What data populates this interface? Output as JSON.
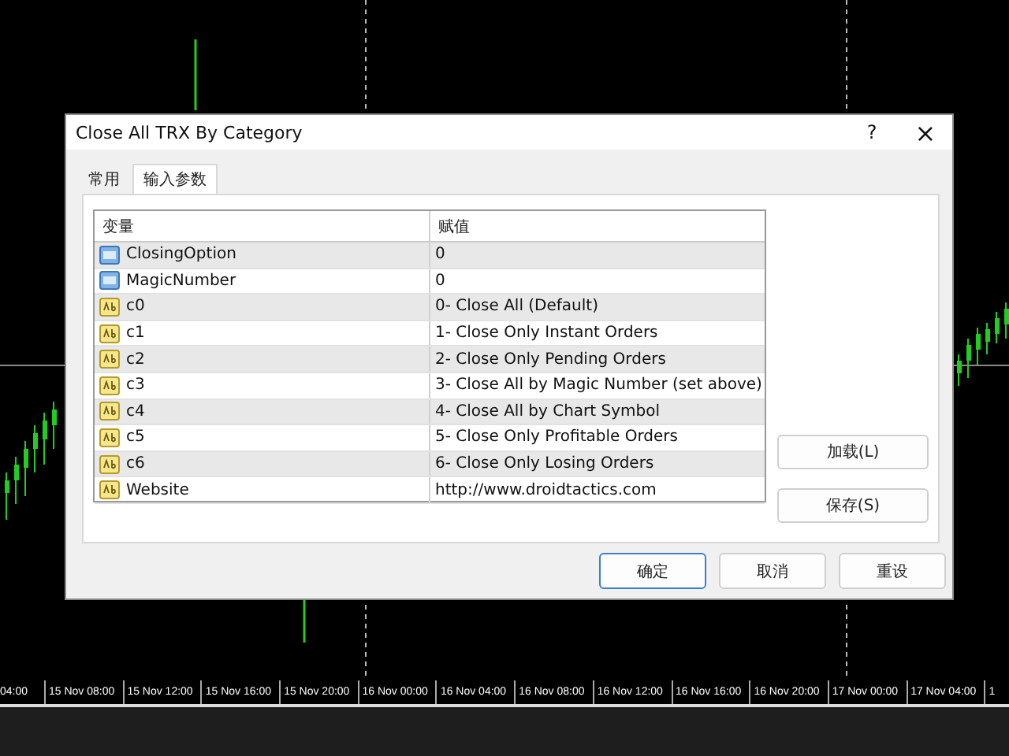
{
  "dialog": {
    "title": "Close All TRX By Category",
    "help_button": "?",
    "close_button": "×"
  },
  "tabs": [
    {
      "label": "常用",
      "selected": false
    },
    {
      "label": "输入参数",
      "selected": true
    }
  ],
  "table": {
    "columns": [
      "变量",
      "赋值"
    ],
    "rows": [
      {
        "kind": "number",
        "name": "ClosingOption",
        "value": "0"
      },
      {
        "kind": "number",
        "name": "MagicNumber",
        "value": "0"
      },
      {
        "kind": "text",
        "name": "c0",
        "value": "0- Close All (Default)"
      },
      {
        "kind": "text",
        "name": "c1",
        "value": "1- Close Only Instant Orders"
      },
      {
        "kind": "text",
        "name": "c2",
        "value": "2- Close Only Pending Orders"
      },
      {
        "kind": "text",
        "name": "c3",
        "value": "3- Close All by Magic Number (set above)"
      },
      {
        "kind": "text",
        "name": "c4",
        "value": "4- Close All by Chart Symbol"
      },
      {
        "kind": "text",
        "name": "c5",
        "value": "5- Close Only Profitable Orders"
      },
      {
        "kind": "text",
        "name": "c6",
        "value": "6- Close Only Losing Orders"
      },
      {
        "kind": "text",
        "name": "Website",
        "value": "http://www.droidtactics.com"
      }
    ]
  },
  "side_buttons": [
    "加载(L)",
    "保存(S)"
  ],
  "footer_buttons": [
    {
      "label": "确定",
      "default": true
    },
    {
      "label": "取消",
      "default": false
    },
    {
      "label": "重设",
      "default": false
    }
  ],
  "time_axis": [
    "04:00",
    "15 Nov 08:00",
    "15 Nov 12:00",
    "15 Nov 16:00",
    "15 Nov 20:00",
    "16 Nov 00:00",
    "16 Nov 04:00",
    "16 Nov 08:00",
    "16 Nov 12:00",
    "16 Nov 16:00",
    "16 Nov 20:00",
    "17 Nov 00:00",
    "17 Nov 04:00",
    "1"
  ]
}
